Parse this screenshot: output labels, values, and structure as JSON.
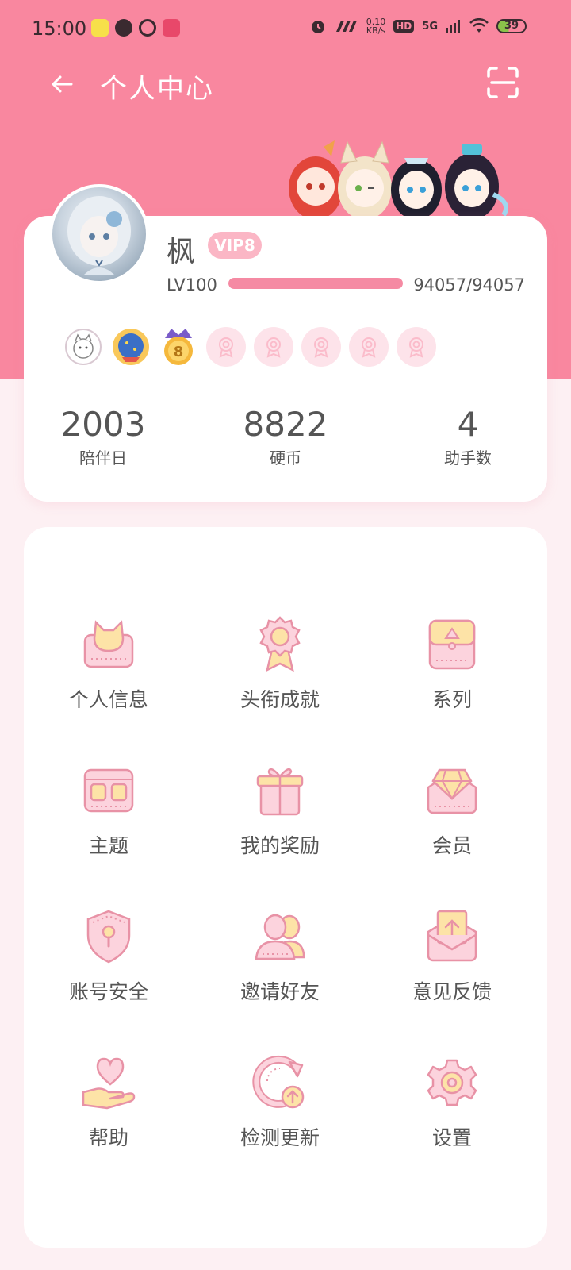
{
  "status_bar": {
    "time": "15:00",
    "speed_value": "0.10",
    "speed_unit": "KB/s",
    "hd_label": "HD",
    "network_label": "5G",
    "battery": "39"
  },
  "topbar": {
    "title": "个人中心",
    "back_icon": "arrow-left-icon",
    "scan_icon": "scan-icon"
  },
  "profile": {
    "name": "枫",
    "vip_label": "VIP8",
    "level": "LV100",
    "exp_text": "94057/94057",
    "exp_fraction": 1.0
  },
  "stats": [
    {
      "value": "2003",
      "label": "陪伴日"
    },
    {
      "value": "8822",
      "label": "硬币"
    },
    {
      "value": "4",
      "label": "助手数"
    }
  ],
  "menu": [
    {
      "label": "个人信息",
      "icon": "cat-card-icon"
    },
    {
      "label": "头衔成就",
      "icon": "medal-icon"
    },
    {
      "label": "系列",
      "icon": "album-icon"
    },
    {
      "label": "主题",
      "icon": "theme-icon"
    },
    {
      "label": "我的奖励",
      "icon": "gift-icon"
    },
    {
      "label": "会员",
      "icon": "diamond-icon"
    },
    {
      "label": "账号安全",
      "icon": "shield-icon"
    },
    {
      "label": "邀请好友",
      "icon": "friends-icon"
    },
    {
      "label": "意见反馈",
      "icon": "feedback-icon"
    },
    {
      "label": "帮助",
      "icon": "heart-hand-icon"
    },
    {
      "label": "检测更新",
      "icon": "update-icon"
    },
    {
      "label": "设置",
      "icon": "gear-icon"
    }
  ],
  "colors": {
    "accent": "#f9879f",
    "icon_fill": "#fcd3dd",
    "icon_stroke": "#e892a6",
    "icon_yellow": "#fde3a7"
  }
}
